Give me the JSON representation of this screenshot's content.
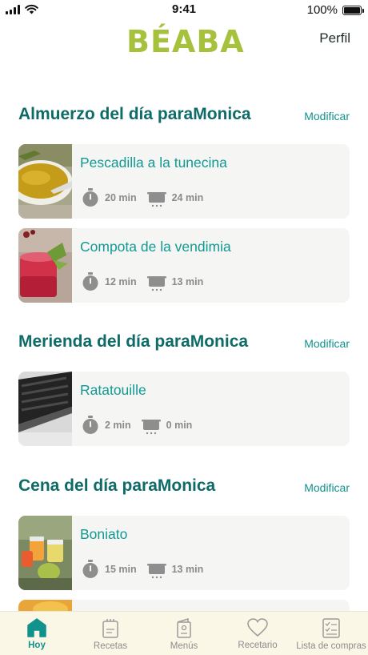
{
  "status_bar": {
    "time": "9:41",
    "battery": "100%",
    "battery_level": 1.0
  },
  "header": {
    "logo": "BÉABA",
    "profile": "Perfil"
  },
  "sections": [
    {
      "title": "Almuerzo del día paraMonica",
      "action": "Modificar",
      "recipes": [
        {
          "name": "Pescadilla a la tunecina",
          "prep_time": "20 min",
          "cook_time": "24 min"
        },
        {
          "name": "Compota de la vendimia",
          "prep_time": "12 min",
          "cook_time": "13 min"
        }
      ]
    },
    {
      "title": "Merienda del día paraMonica",
      "action": "Modificar",
      "recipes": [
        {
          "name": "Ratatouille",
          "prep_time": "2 min",
          "cook_time": "0 min"
        }
      ]
    },
    {
      "title": "Cena del día paraMonica",
      "action": "Modificar",
      "recipes": [
        {
          "name": "Boniato",
          "prep_time": "15 min",
          "cook_time": "13 min"
        }
      ]
    }
  ],
  "tabs": [
    {
      "label": "Hoy",
      "icon": "home-icon",
      "active": true
    },
    {
      "label": "Recetas",
      "icon": "recipes-icon",
      "active": false
    },
    {
      "label": "Menús",
      "icon": "menu-book-icon",
      "active": false
    },
    {
      "label": "Recetario",
      "icon": "heart-icon",
      "active": false
    },
    {
      "label": "Lista de compras",
      "icon": "checklist-icon",
      "active": false
    }
  ],
  "colors": {
    "brand": "#a6c23c",
    "accent": "#11928c",
    "heading": "#0e6b68",
    "card_bg": "#f5f5f3",
    "tab_bg": "#fbf7e7",
    "meta_icon": "#8e8e8e"
  }
}
